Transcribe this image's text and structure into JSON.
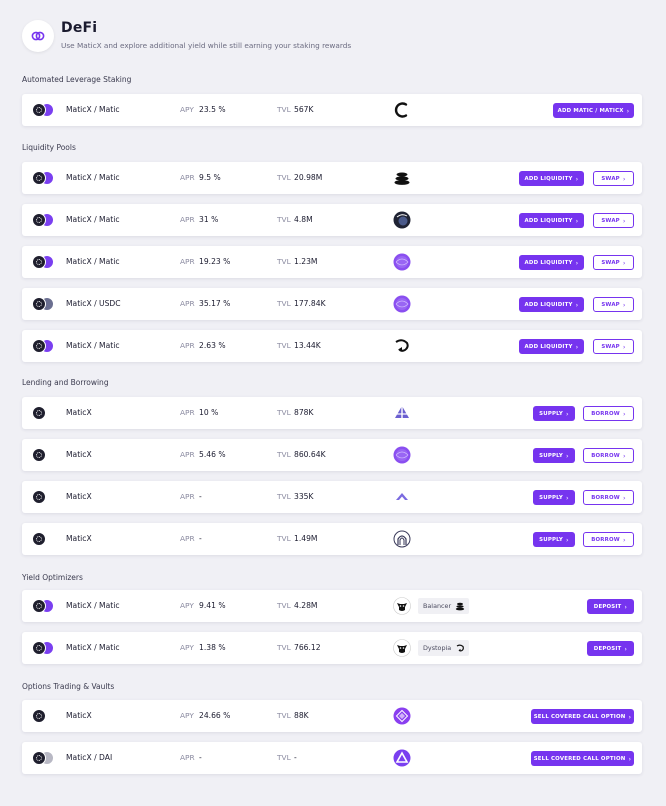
{
  "header": {
    "title": "DeFi",
    "subtitle": "Use MaticX and explore additional yield while still earning your staking rewards"
  },
  "sections": {
    "leverage": "Automated Leverage Staking",
    "liquidity": "Liquidity Pools",
    "lending": "Lending and Borrowing",
    "yield": "Yield Optimizers",
    "options": "Options Trading & Vaults"
  },
  "rows": [
    {
      "pair": "MaticX / Matic",
      "apy_label": "APY",
      "apy": "23.5 %",
      "tvl_label": "TVL",
      "tvl": "567K",
      "protocol_icon": "ring-logo-icon",
      "primary": "ADD MATIC / MATICX",
      "secondary": ""
    },
    {
      "pair": "MaticX / Matic",
      "apy_label": "APR",
      "apy": "9.5 %",
      "tvl_label": "TVL",
      "tvl": "20.98M",
      "protocol_icon": "stack-logo-icon",
      "primary": "ADD LIQUIDITY",
      "secondary": "SWAP"
    },
    {
      "pair": "MaticX / Matic",
      "apy_label": "APR",
      "apy": "31 %",
      "tvl_label": "TVL",
      "tvl": "4.8M",
      "protocol_icon": "globe-logo-icon",
      "primary": "ADD LIQUIDITY",
      "secondary": "SWAP"
    },
    {
      "pair": "MaticX / Matic",
      "apy_label": "APR",
      "apy": "19.23 %",
      "tvl_label": "TVL",
      "tvl": "1.23M",
      "protocol_icon": "purple-orb-icon",
      "primary": "ADD LIQUIDITY",
      "secondary": "SWAP"
    },
    {
      "pair": "MaticX / USDC",
      "apy_label": "APR",
      "apy": "35.17 %",
      "tvl_label": "TVL",
      "tvl": "177.84K",
      "protocol_icon": "purple-orb-icon",
      "primary": "ADD LIQUIDITY",
      "secondary": "SWAP"
    },
    {
      "pair": "MaticX / Matic",
      "apy_label": "APR",
      "apy": "2.63 %",
      "tvl_label": "TVL",
      "tvl": "13.44K",
      "protocol_icon": "swirl-logo-icon",
      "primary": "ADD LIQUIDITY",
      "secondary": "SWAP"
    },
    {
      "pair": "MaticX",
      "apy_label": "APR",
      "apy": "10 %",
      "tvl_label": "TVL",
      "tvl": "878K",
      "protocol_icon": "triangle-logo-icon",
      "primary": "SUPPLY",
      "secondary": "BORROW"
    },
    {
      "pair": "MaticX",
      "apy_label": "APR",
      "apy": "5.46 %",
      "tvl_label": "TVL",
      "tvl": "860.64K",
      "protocol_icon": "purple-orb-icon",
      "primary": "SUPPLY",
      "secondary": "BORROW"
    },
    {
      "pair": "MaticX",
      "apy_label": "APR",
      "apy": "-",
      "tvl_label": "TVL",
      "tvl": "335K",
      "protocol_icon": "ghost-logo-icon",
      "primary": "SUPPLY",
      "secondary": "BORROW"
    },
    {
      "pair": "MaticX",
      "apy_label": "APR",
      "apy": "-",
      "tvl_label": "TVL",
      "tvl": "1.49M",
      "protocol_icon": "arch-logo-icon",
      "primary": "SUPPLY",
      "secondary": "BORROW"
    },
    {
      "pair": "MaticX / Matic",
      "apy_label": "APY",
      "apy": "9.41 %",
      "tvl_label": "TVL",
      "tvl": "4.28M",
      "protocol_icon": "cow-logo-icon",
      "chip": "Balancer",
      "chip_icon": "stack-logo-icon",
      "primary": "DEPOSIT",
      "secondary": ""
    },
    {
      "pair": "MaticX / Matic",
      "apy_label": "APY",
      "apy": "1.38 %",
      "tvl_label": "TVL",
      "tvl": "766.12",
      "protocol_icon": "cow-logo-icon",
      "chip": "Dystopia",
      "chip_icon": "swirl-logo-icon",
      "primary": "DEPOSIT",
      "secondary": ""
    },
    {
      "pair": "MaticX",
      "apy_label": "APY",
      "apy": "24.66 %",
      "tvl_label": "TVL",
      "tvl": "88K",
      "protocol_icon": "diamond-logo-icon",
      "primary": "SELL COVERED CALL OPTION",
      "secondary": ""
    },
    {
      "pair": "MaticX / DAI",
      "apy_label": "APR",
      "apy": "-",
      "tvl_label": "TVL",
      "tvl": "-",
      "protocol_icon": "delta-logo-icon",
      "primary": "SELL COVERED CALL OPTION",
      "secondary": ""
    }
  ],
  "colors": {
    "accent": "#7634ef",
    "background": "#f0f0f5",
    "card": "#ffffff"
  }
}
